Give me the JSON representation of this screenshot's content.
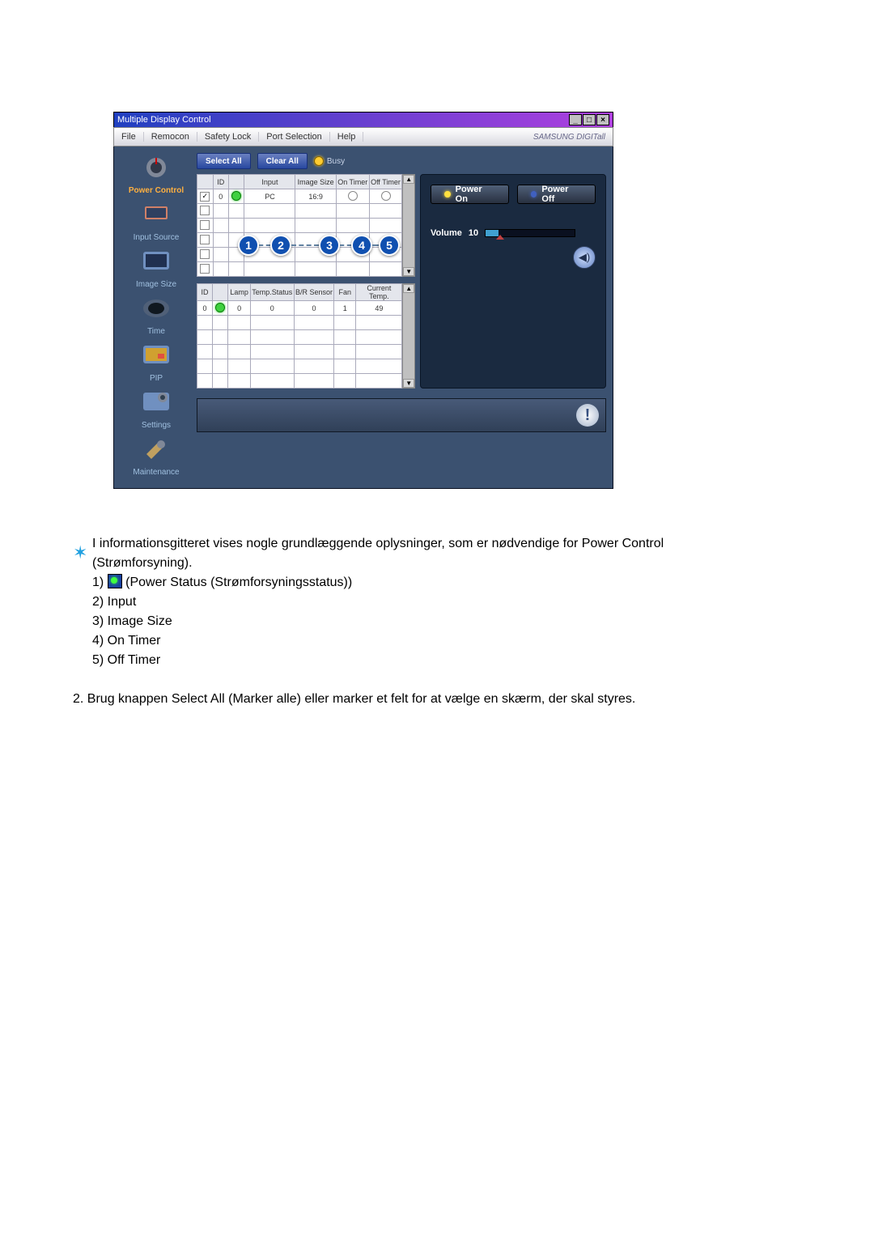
{
  "window": {
    "title": "Multiple Display Control",
    "brand": "SAMSUNG DIGITall"
  },
  "menu": {
    "file": "File",
    "remocon": "Remocon",
    "safety": "Safety Lock",
    "port": "Port Selection",
    "help": "Help"
  },
  "sidebar": [
    {
      "label": "Power Control",
      "active": true
    },
    {
      "label": "Input Source"
    },
    {
      "label": "Image Size"
    },
    {
      "label": "Time"
    },
    {
      "label": "PIP"
    },
    {
      "label": "Settings"
    },
    {
      "label": "Maintenance"
    }
  ],
  "toolbar": {
    "selectall": "Select All",
    "clearall": "Clear All",
    "busy": "Busy"
  },
  "grid_top": {
    "headers": [
      "",
      "ID",
      "",
      "Input",
      "Image Size",
      "On Timer",
      "Off Timer"
    ],
    "rows": [
      {
        "chk": true,
        "id": "0",
        "pwr": "on",
        "input": "PC",
        "size": "16:9",
        "on": "o",
        "off": "o"
      },
      {
        "chk": false,
        "id": "",
        "pwr": "",
        "input": "",
        "size": "",
        "on": "",
        "off": ""
      },
      {
        "chk": false,
        "id": "",
        "pwr": "",
        "input": "",
        "size": "",
        "on": "",
        "off": ""
      },
      {
        "chk": false,
        "id": "",
        "pwr": "",
        "input": "",
        "size": "",
        "on": "",
        "off": ""
      },
      {
        "chk": false,
        "id": "",
        "pwr": "",
        "input": "",
        "size": "",
        "on": "",
        "off": ""
      },
      {
        "chk": false,
        "id": "",
        "pwr": "",
        "input": "",
        "size": "",
        "on": "",
        "off": ""
      }
    ]
  },
  "grid_bottom": {
    "headers": [
      "ID",
      "",
      "Lamp",
      "Temp.Status",
      "B/R Sensor",
      "Fan",
      "Current Temp."
    ],
    "rows": [
      {
        "id": "0",
        "pwr": "on",
        "lamp": "0",
        "ts": "0",
        "br": "0",
        "fan": "1",
        "ct": "49"
      },
      {
        "id": "",
        "pwr": "",
        "lamp": "",
        "ts": "",
        "br": "",
        "fan": "",
        "ct": ""
      },
      {
        "id": "",
        "pwr": "",
        "lamp": "",
        "ts": "",
        "br": "",
        "fan": "",
        "ct": ""
      },
      {
        "id": "",
        "pwr": "",
        "lamp": "",
        "ts": "",
        "br": "",
        "fan": "",
        "ct": ""
      },
      {
        "id": "",
        "pwr": "",
        "lamp": "",
        "ts": "",
        "br": "",
        "fan": "",
        "ct": ""
      },
      {
        "id": "",
        "pwr": "",
        "lamp": "",
        "ts": "",
        "br": "",
        "fan": "",
        "ct": ""
      }
    ]
  },
  "power": {
    "on": "Power On",
    "off": "Power Off",
    "volume_label": "Volume",
    "volume_value": "10"
  },
  "callouts": [
    "1",
    "2",
    "3",
    "4",
    "5"
  ],
  "doc": {
    "p1": "I informationsgitteret vises nogle grundlæggende oplysninger, som er nødvendige for Power Control (Strømforsyning).",
    "l1": "1)",
    "l1b": "(Power Status (Strømforsyningsstatus))",
    "l2": "2) Input",
    "l3": "3) Image Size",
    "l4": "4) On Timer",
    "l5": "5) Off Timer",
    "p2": "2. Brug knappen Select All (Marker alle) eller marker et felt for at vælge en skærm, der skal styres."
  }
}
